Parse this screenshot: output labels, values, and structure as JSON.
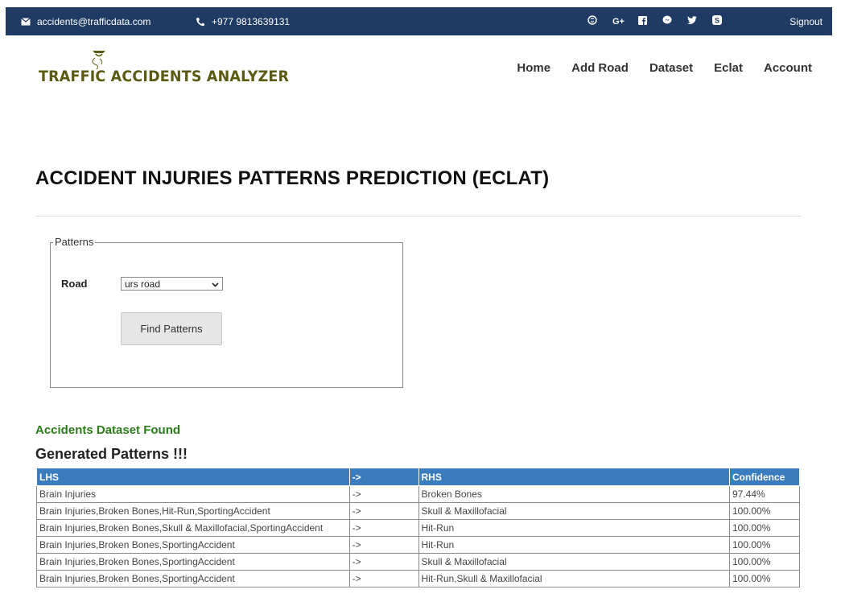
{
  "topbar": {
    "email": "accidents@trafficdata.com",
    "phone": "+977 9813639131",
    "socials": [
      "skype-icon",
      "google-plus-icon",
      "facebook-icon",
      "messenger-icon",
      "twitter-icon",
      "skype-alt-icon"
    ],
    "signout": "Signout"
  },
  "brand": {
    "name": "TRAFFIC ACCIDENTS ANALYZER",
    "color": "#5b5a12"
  },
  "nav": {
    "home": "Home",
    "add_road": "Add Road",
    "dataset": "Dataset",
    "eclat": "Eclat",
    "account": "Account"
  },
  "page_title": "ACCIDENT INJURIES PATTERNS PREDICTION (ECLAT)",
  "form": {
    "legend": "Patterns",
    "road_label": "Road",
    "road_value": "urs road",
    "button_label": "Find Patterns"
  },
  "results": {
    "found_message": "Accidents Dataset Found",
    "generated_title": "Generated Patterns !!!",
    "headers": {
      "lhs": "LHS",
      "arrow": "->",
      "rhs": "RHS",
      "confidence": "Confidence"
    },
    "rows": [
      {
        "lhs": "Brain Injuries",
        "arrow": "->",
        "rhs": "Broken Bones",
        "confidence": "97.44%"
      },
      {
        "lhs": "Brain Injuries,Broken Bones,Hit-Run,SportingAccident",
        "arrow": "->",
        "rhs": "Skull & Maxillofacial",
        "confidence": "100.00%"
      },
      {
        "lhs": "Brain Injuries,Broken Bones,Skull & Maxillofacial,SportingAccident",
        "arrow": "->",
        "rhs": "Hit-Run",
        "confidence": "100.00%"
      },
      {
        "lhs": "Brain Injuries,Broken Bones,SportingAccident",
        "arrow": "->",
        "rhs": "Hit-Run",
        "confidence": "100.00%"
      },
      {
        "lhs": "Brain Injuries,Broken Bones,SportingAccident",
        "arrow": "->",
        "rhs": "Skull & Maxillofacial",
        "confidence": "100.00%"
      },
      {
        "lhs": "Brain Injuries,Broken Bones,SportingAccident",
        "arrow": "->",
        "rhs": "Hit-Run,Skull & Maxillofacial",
        "confidence": "100.00%"
      }
    ]
  },
  "colors": {
    "topbar": "#1f3b63",
    "table_header": "#3b7cbf",
    "found_message": "#2a7d19"
  }
}
